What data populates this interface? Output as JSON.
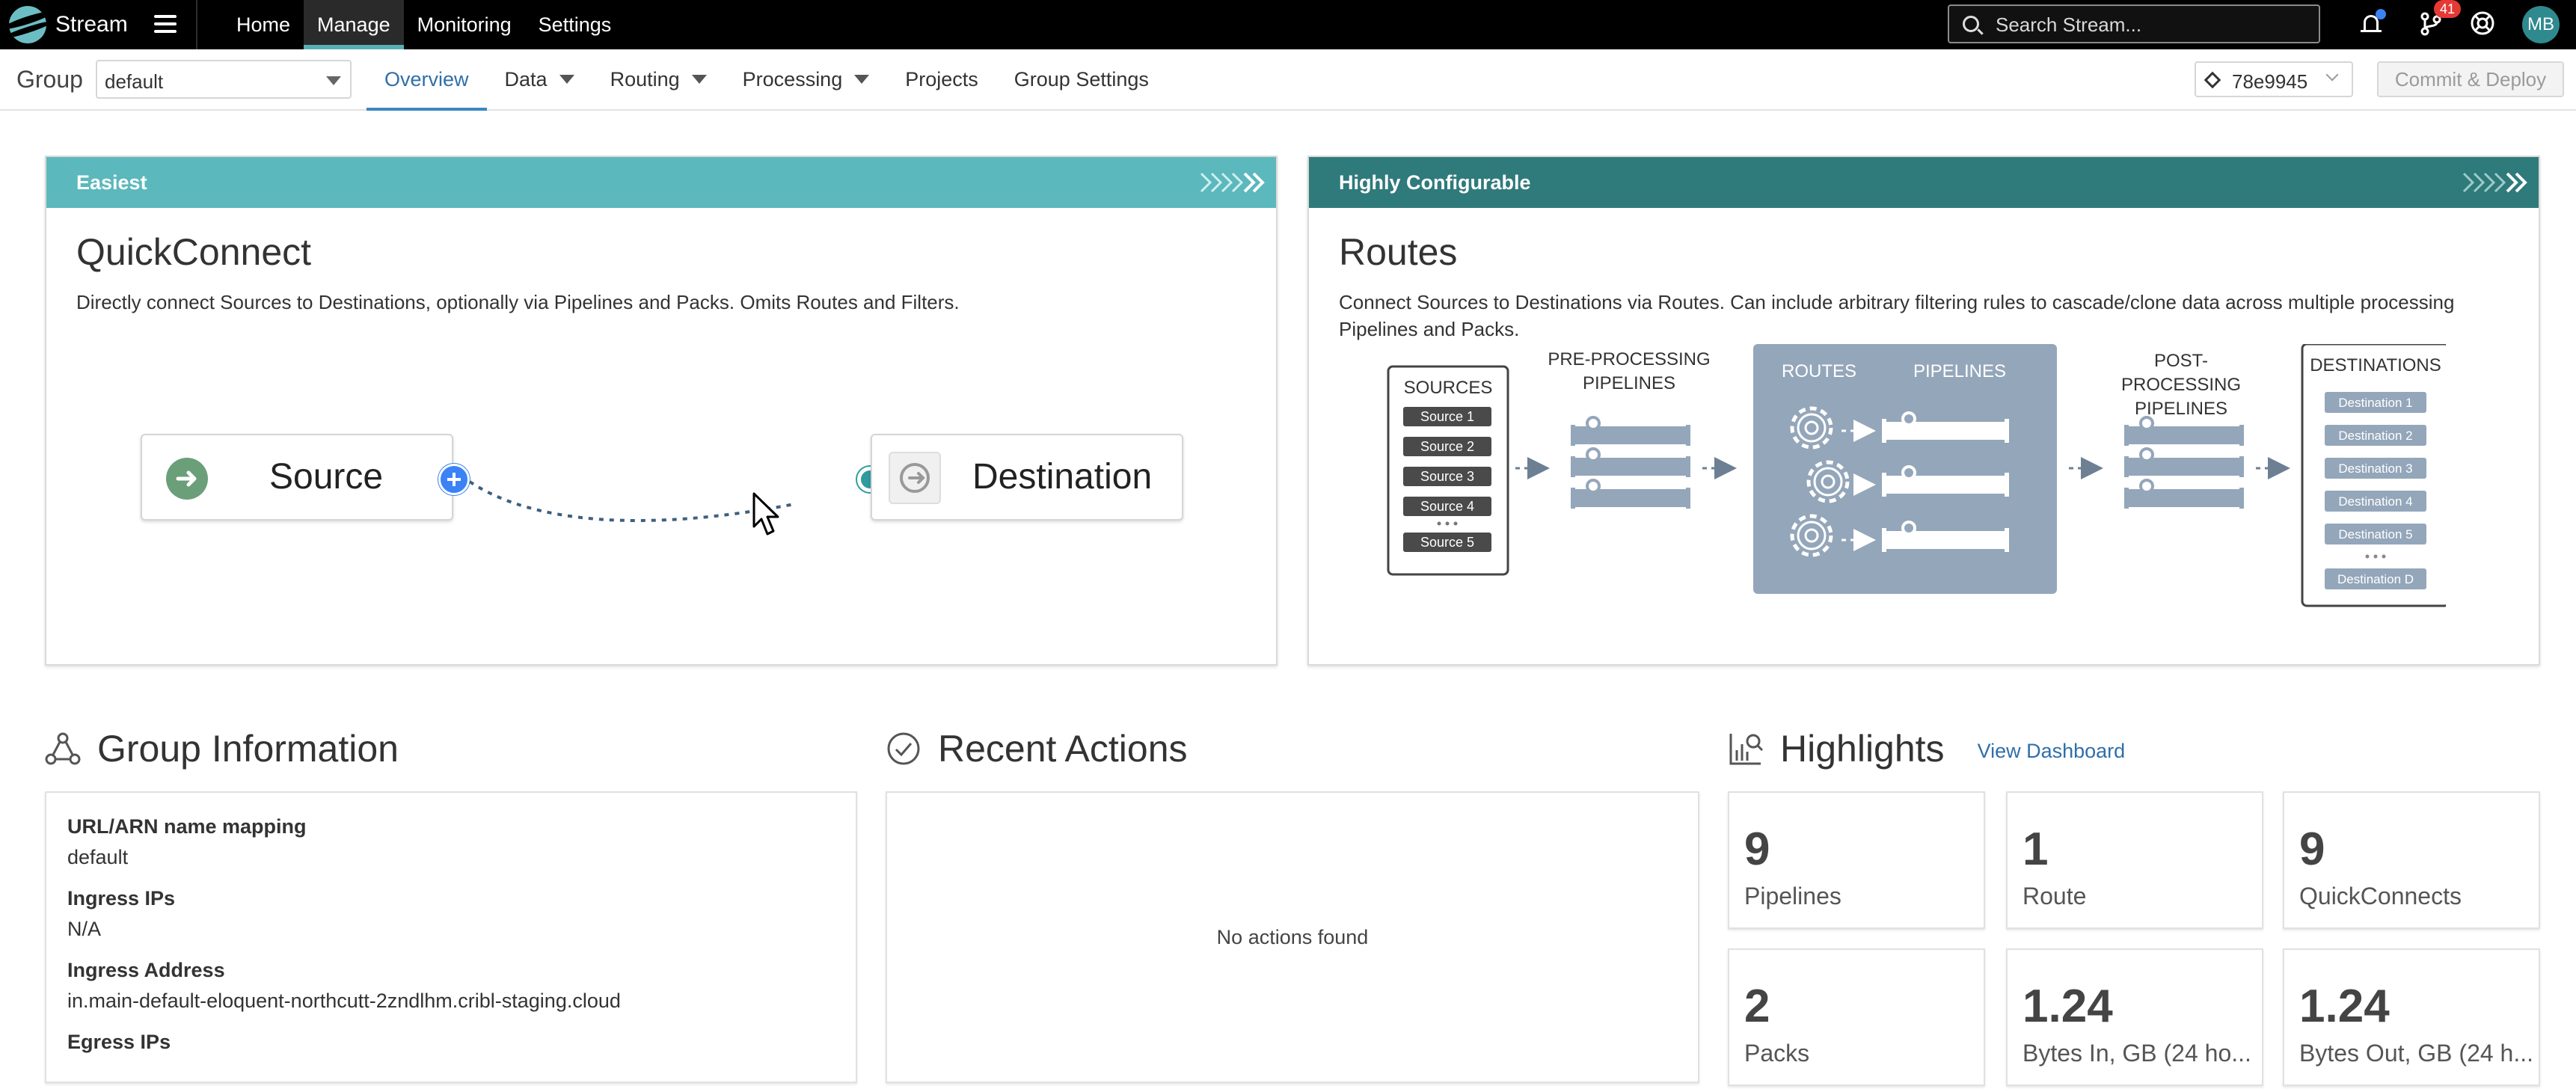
{
  "app": {
    "name": "Stream"
  },
  "topnav": {
    "items": [
      "Home",
      "Manage",
      "Monitoring",
      "Settings"
    ]
  },
  "search": {
    "placeholder": "Search Stream..."
  },
  "notifications": {
    "badge_count": "41"
  },
  "user": {
    "initials": "MB"
  },
  "subnav": {
    "group_label": "Group",
    "group_value": "default",
    "tabs": [
      "Overview",
      "Data",
      "Routing",
      "Processing",
      "Projects",
      "Group Settings"
    ],
    "commit_value": "78e9945",
    "deploy_label": "Commit & Deploy"
  },
  "quickconnect": {
    "badge": "Easiest",
    "title": "QuickConnect",
    "description": "Directly connect Sources to Destinations, optionally via Pipelines and Packs. Omits Routes and Filters.",
    "source_label": "Source",
    "destination_label": "Destination"
  },
  "routes": {
    "badge": "Highly Configurable",
    "title": "Routes",
    "description": "Connect Sources to Destinations via Routes. Can include arbitrary filtering rules to cascade/clone data across multiple processing Pipelines and Packs.",
    "diagram": {
      "sources_title": "SOURCES",
      "sources": [
        "Source 1",
        "Source 2",
        "Source 3",
        "Source 4",
        "Source 5"
      ],
      "pre_title_1": "PRE-PROCESSING",
      "pre_title_2": "PIPELINES",
      "routes_title": "ROUTES",
      "pipelines_title": "PIPELINES",
      "post_title_1": "POST-",
      "post_title_2": "PROCESSING",
      "post_title_3": "PIPELINES",
      "destinations_title": "DESTINATIONS",
      "destinations": [
        "Destination 1",
        "Destination 2",
        "Destination 3",
        "Destination 4",
        "Destination 5",
        "Destination D"
      ]
    }
  },
  "group_info": {
    "title": "Group Information",
    "rows": [
      {
        "key": "URL/ARN name mapping",
        "value": "default"
      },
      {
        "key": "Ingress IPs",
        "value": "N/A"
      },
      {
        "key": "Ingress Address",
        "value": "in.main-default-eloquent-northcutt-2zndlhm.cribl-staging.cloud"
      },
      {
        "key": "Egress IPs",
        "value": ""
      }
    ]
  },
  "recent_actions": {
    "title": "Recent Actions",
    "empty_text": "No actions found"
  },
  "highlights": {
    "title": "Highlights",
    "link": "View Dashboard",
    "stats": [
      {
        "value": "9",
        "label": "Pipelines"
      },
      {
        "value": "1",
        "label": "Route"
      },
      {
        "value": "9",
        "label": "QuickConnects"
      },
      {
        "value": "2",
        "label": "Packs"
      },
      {
        "value": "1.24",
        "label": "Bytes In, GB (24 ho..."
      },
      {
        "value": "1.24",
        "label": "Bytes Out, GB (24 h..."
      }
    ]
  },
  "colors": {
    "accent_blue": "#2f6fa8",
    "easiest_header": "#5bb8bc",
    "configurable_header": "#2f7a7b",
    "diagram_fill": "#94a6ba"
  }
}
